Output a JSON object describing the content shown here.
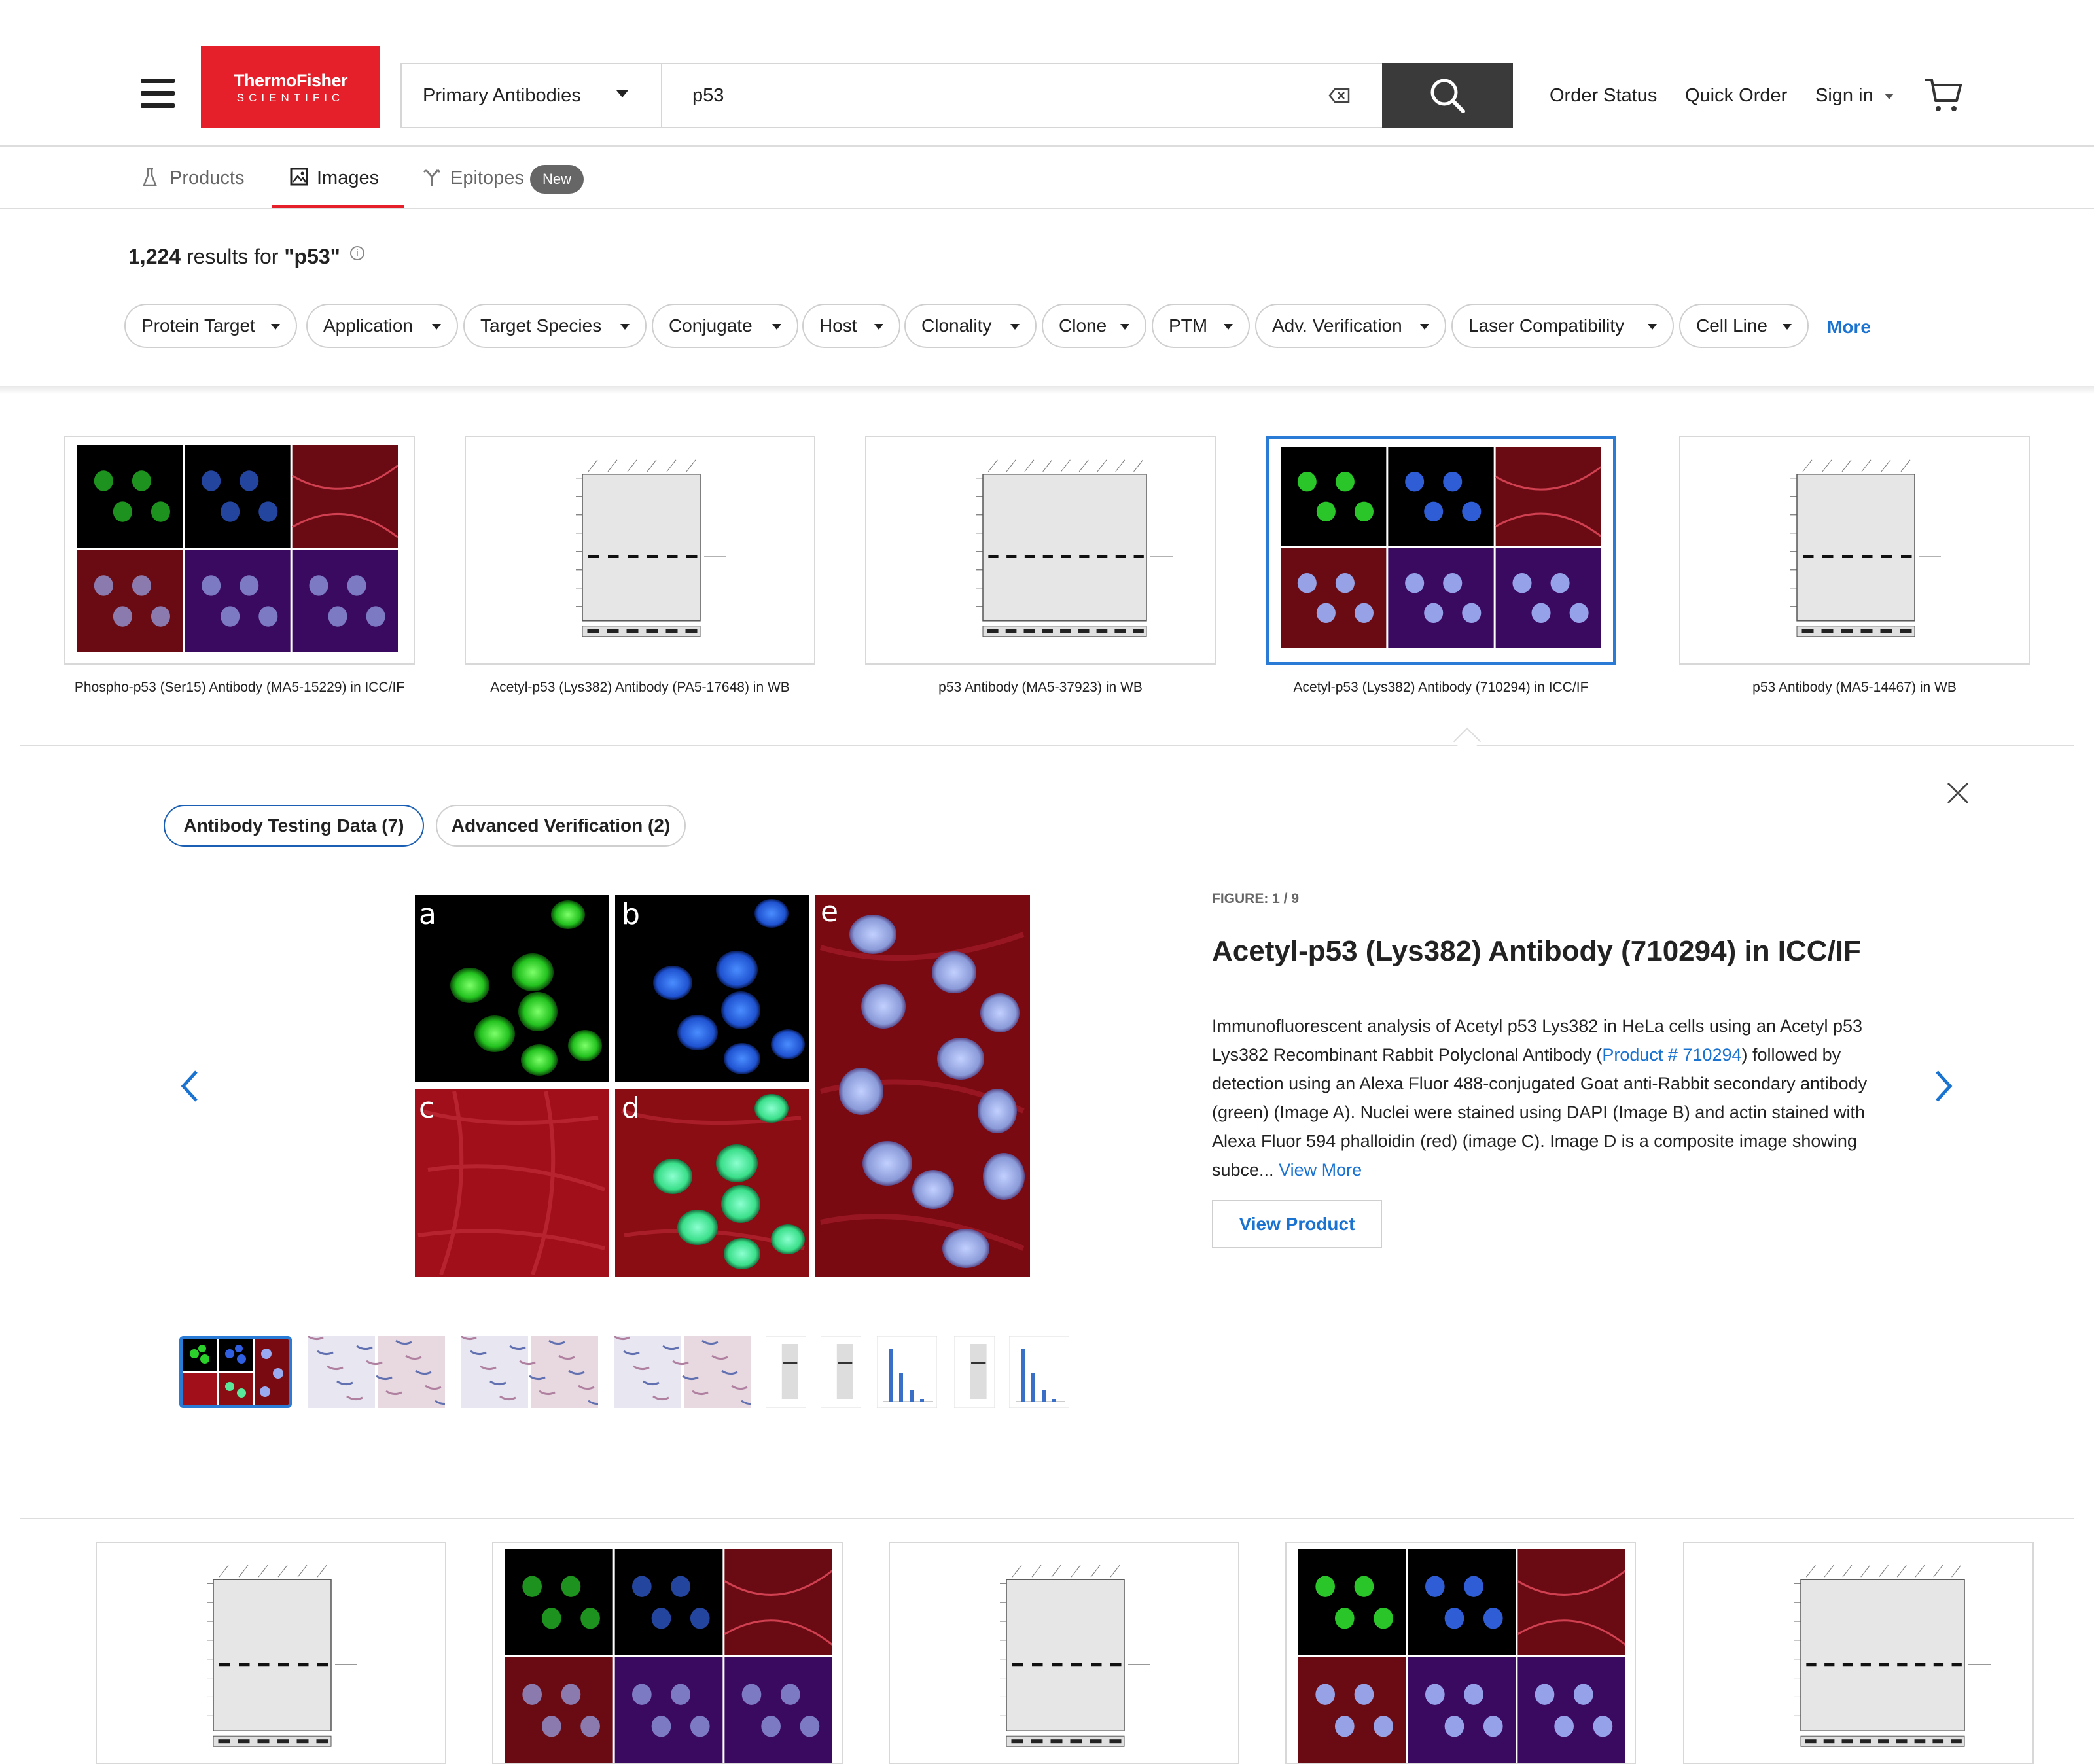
{
  "header": {
    "logo_line1": "ThermoFisher",
    "logo_line2": "SCIENTIFIC",
    "category": "Primary Antibodies",
    "search_value": "p53",
    "nav": {
      "order_status": "Order Status",
      "quick_order": "Quick Order",
      "sign_in": "Sign in"
    }
  },
  "tabs": [
    {
      "label": "Products",
      "active": false
    },
    {
      "label": "Images",
      "active": true
    },
    {
      "label": "Epitopes",
      "active": false,
      "badge": "New"
    }
  ],
  "results": {
    "count": "1,224",
    "text_prefix": "results for",
    "query": "\"p53\""
  },
  "filters": [
    "Protein Target",
    "Application",
    "Target Species",
    "Conjugate",
    "Host",
    "Clonality",
    "Clone",
    "PTM",
    "Adv. Verification",
    "Laser Compatibility",
    "Cell Line"
  ],
  "filters_more": "More",
  "cards": [
    {
      "caption": "Phospho-p53 (Ser15) Antibody (MA5-15229) in ICC/IF",
      "type": "if"
    },
    {
      "caption": "Acetyl-p53 (Lys382) Antibody (PA5-17648) in WB",
      "type": "wb"
    },
    {
      "caption": "p53 Antibody (MA5-37923) in WB",
      "type": "wb"
    },
    {
      "caption": "Acetyl-p53 (Lys382) Antibody (710294) in ICC/IF",
      "type": "if",
      "selected": true
    },
    {
      "caption": "p53 Antibody (MA5-14467) in WB",
      "type": "wb"
    }
  ],
  "detail": {
    "segments": [
      "Antibody Testing Data (7)",
      "Advanced Verification (2)"
    ],
    "figure_label": "FIGURE: 1 / 9",
    "title": "Acetyl-p53 (Lys382) Antibody (710294) in ICC/IF",
    "desc_before": "Immunofluorescent analysis of Acetyl p53 Lys382 in HeLa cells using an Acetyl p53 Lys382 Recombinant Rabbit Polyclonal Antibody (",
    "desc_link": "Product # 710294",
    "desc_after": ") followed by detection using an Alexa Fluor 488-conjugated Goat anti-Rabbit secondary antibody (green) (Image A). Nuclei were stained using DAPI (Image B) and actin stained with Alexa Fluor 594 phalloidin (red) (image C). Image D is a composite image showing subce... ",
    "view_more": "View More",
    "view_product": "View Product",
    "panel_letters": [
      "a",
      "b",
      "c",
      "d",
      "e"
    ]
  },
  "bottom_cards": [
    "wb",
    "if",
    "wb",
    "if",
    "wb"
  ],
  "colors": {
    "brand_red": "#e5202a",
    "accent_blue": "#1a73d1",
    "select_blue": "#2a7bd6"
  }
}
